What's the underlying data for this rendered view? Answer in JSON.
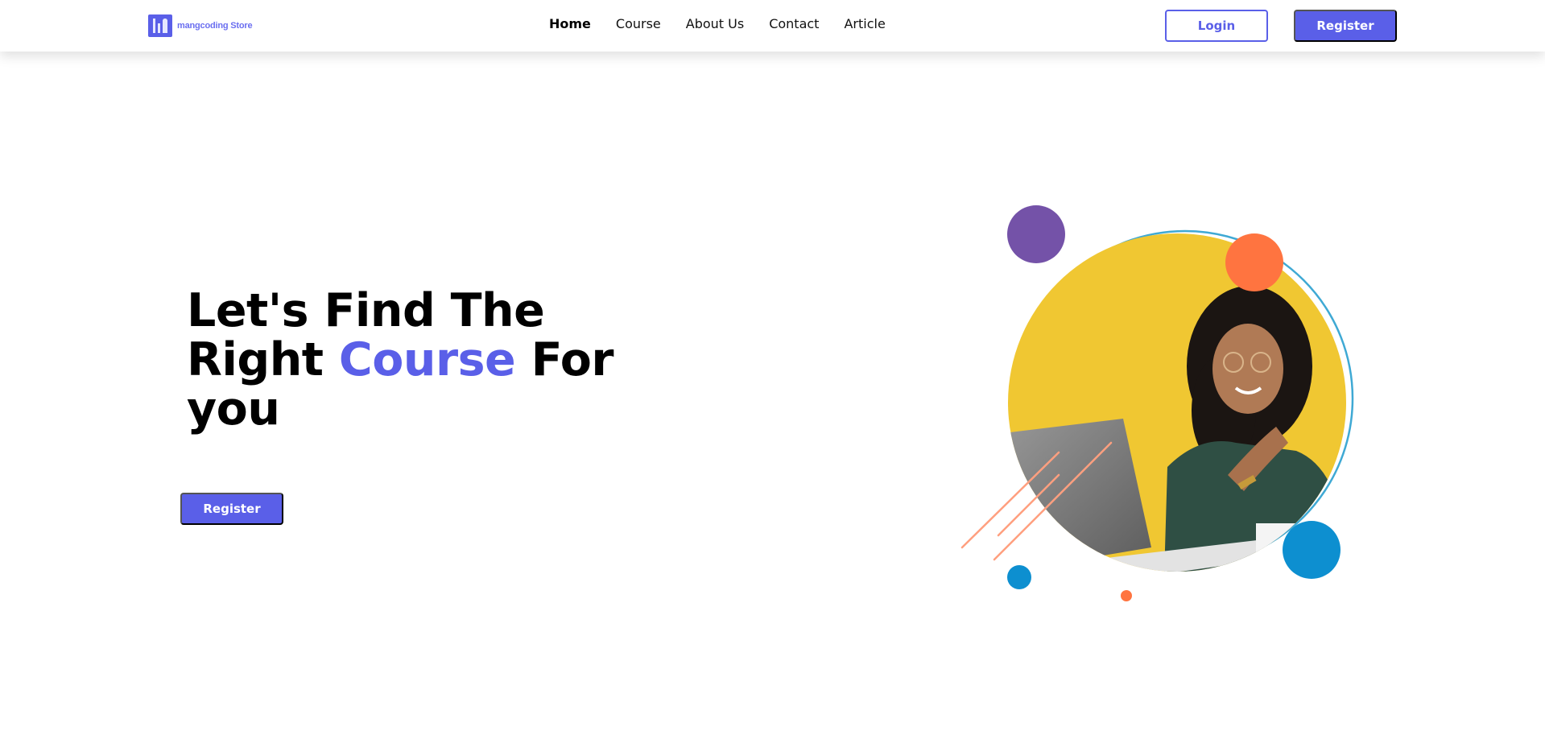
{
  "header": {
    "brand_text": "mangcoding Store",
    "nav": [
      {
        "label": "Home",
        "active": true
      },
      {
        "label": "Course",
        "active": false
      },
      {
        "label": "About Us",
        "active": false
      },
      {
        "label": "Contact",
        "active": false
      },
      {
        "label": "Article",
        "active": false
      }
    ],
    "login_label": "Login",
    "register_label": "Register"
  },
  "hero": {
    "title_part1": "Let's Find The Right",
    "title_accent": "Course",
    "title_part2": "For you",
    "register_label": "Register"
  },
  "colors": {
    "primary": "#5a5fe8",
    "yellow": "#f0c732",
    "purple": "#7452a8",
    "orange": "#ff7440",
    "blue": "#0d8fd0"
  }
}
